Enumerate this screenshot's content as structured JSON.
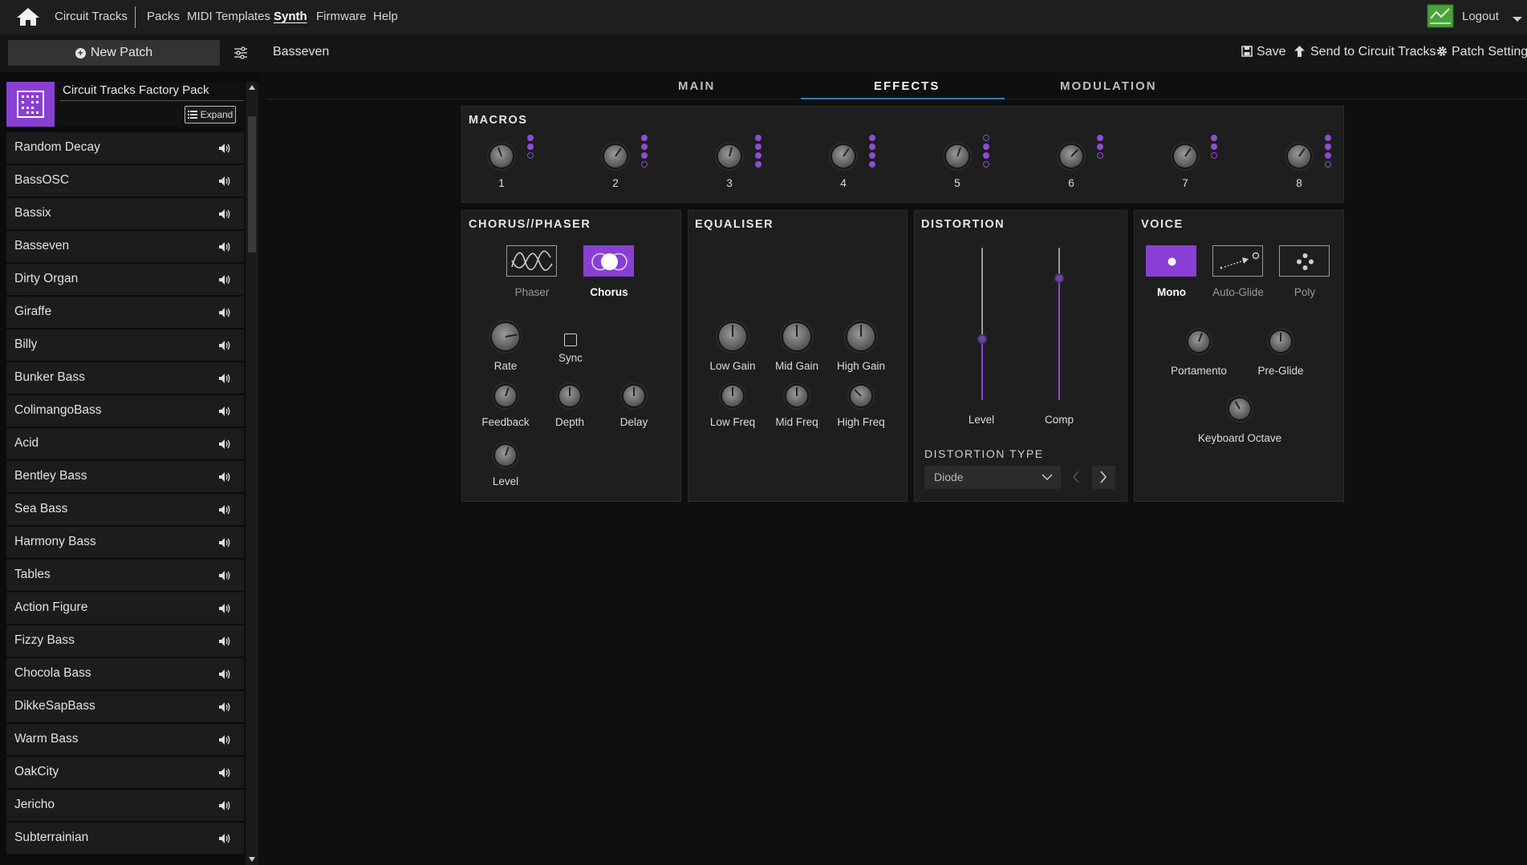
{
  "nav": {
    "brand": "Circuit Tracks",
    "links": [
      "Packs",
      "MIDI Templates",
      "Synth",
      "Firmware",
      "Help"
    ],
    "active": "Synth",
    "logout": "Logout"
  },
  "toolbar": {
    "new_patch": "New Patch",
    "patch_name": "Basseven",
    "save": "Save",
    "send": "Send to Circuit Tracks",
    "settings": "Patch Settings"
  },
  "sidebar": {
    "pack_name": "Circuit Tracks Factory Pack",
    "expand": "Expand",
    "patches": [
      "Random Decay",
      "BassOSC",
      "Bassix",
      "Basseven",
      "Dirty Organ",
      "Giraffe",
      "Billy",
      "Bunker Bass",
      "ColimangoBass",
      "Acid",
      "Bentley Bass",
      "Sea Bass",
      "Harmony Bass",
      "Tables",
      "Action Figure",
      "Fizzy Bass",
      "Chocola Bass",
      "DikkeSapBass",
      "Warm Bass",
      "OakCity",
      "Jericho",
      "Subterrainian"
    ]
  },
  "tabs": [
    "MAIN",
    "EFFECTS",
    "MODULATION"
  ],
  "active_tab": "EFFECTS",
  "macros": {
    "title": "MACROS",
    "labels": [
      "1",
      "2",
      "3",
      "4",
      "5",
      "6",
      "7",
      "8"
    ],
    "dots": [
      [
        1,
        1,
        0
      ],
      [
        1,
        1,
        1,
        0
      ],
      [
        1,
        1,
        1,
        1
      ],
      [
        1,
        1,
        1,
        1
      ],
      [
        0,
        1,
        1,
        0
      ],
      [
        1,
        1,
        0
      ],
      [
        1,
        1,
        0
      ],
      [
        1,
        1,
        1,
        0
      ]
    ]
  },
  "chorus": {
    "title": "CHORUS//PHASER",
    "types": [
      "Phaser",
      "Chorus"
    ],
    "selected": "Chorus",
    "sync": "Sync",
    "knobs": [
      "Rate",
      "Feedback",
      "Depth",
      "Delay",
      "Level"
    ]
  },
  "eq": {
    "title": "EQUALISER",
    "knobs": [
      "Low Gain",
      "Mid Gain",
      "High Gain",
      "Low Freq",
      "Mid Freq",
      "High Freq"
    ]
  },
  "distortion": {
    "title": "DISTORTION",
    "sliders": [
      "Level",
      "Comp"
    ],
    "level_value": 0.4,
    "comp_value": 0.8,
    "type_title": "DISTORTION TYPE",
    "type_value": "Diode"
  },
  "voice": {
    "title": "VOICE",
    "modes": [
      "Mono",
      "Auto-Glide",
      "Poly"
    ],
    "selected": "Mono",
    "knobs": [
      "Portamento",
      "Pre-Glide",
      "Keyboard Octave"
    ]
  }
}
